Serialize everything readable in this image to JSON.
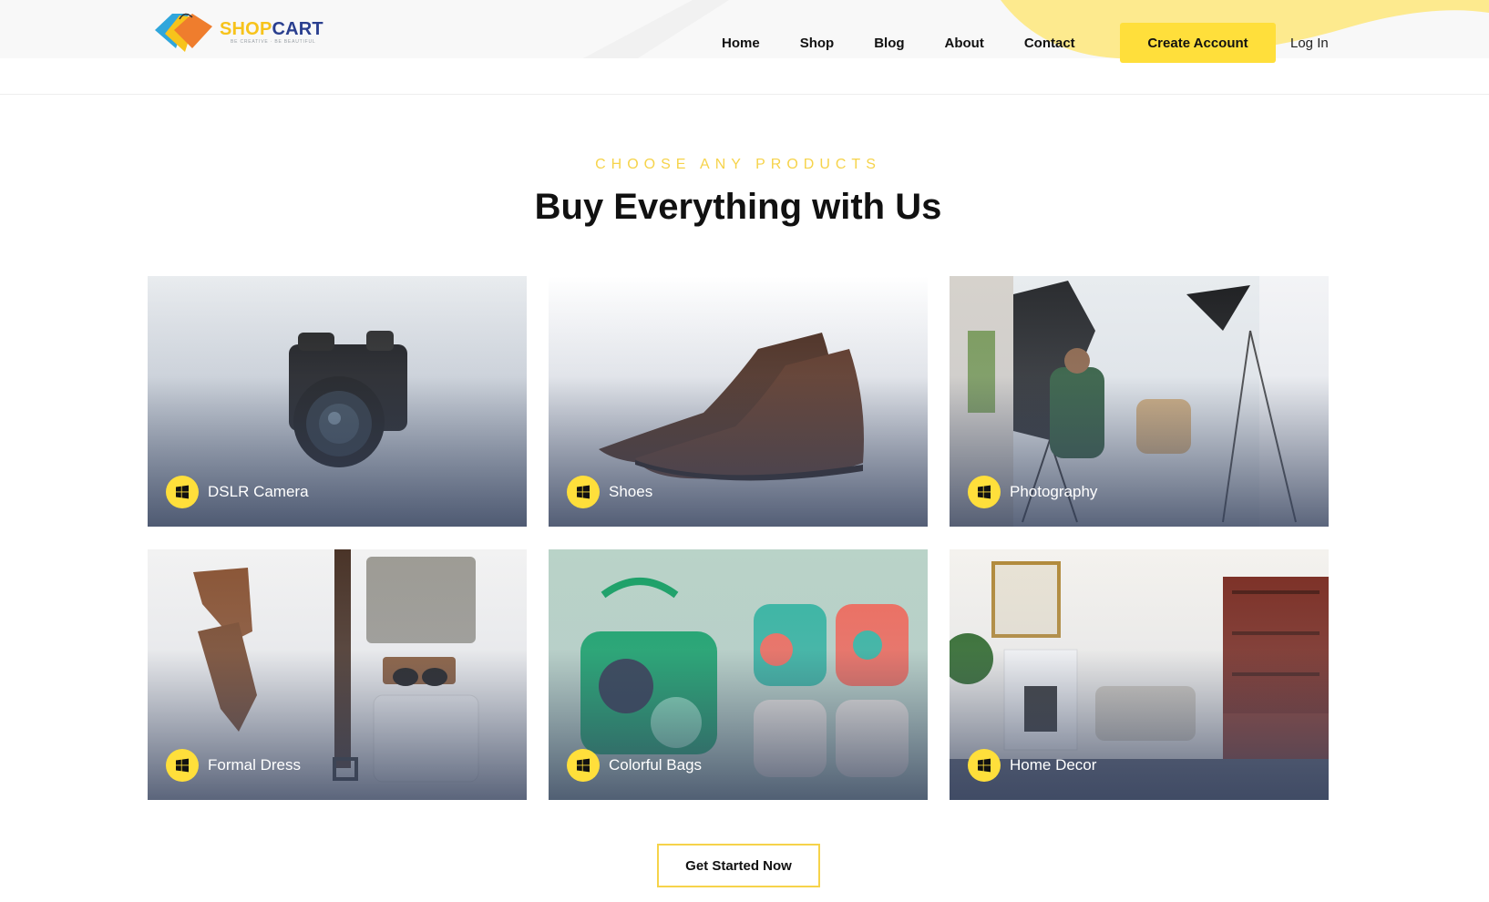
{
  "brand": {
    "name_part1": "SHOP",
    "name_part2": "CART",
    "tagline": "BE CREATIVE · BE BEAUTIFUL",
    "logo_icon": "shopping-tags-icon"
  },
  "nav": {
    "items": [
      {
        "label": "Home"
      },
      {
        "label": "Shop"
      },
      {
        "label": "Blog"
      },
      {
        "label": "About"
      },
      {
        "label": "Contact"
      }
    ],
    "create_account": "Create Account",
    "login": "Log In"
  },
  "section": {
    "eyebrow": "CHOOSE ANY PRODUCTS",
    "title": "Buy Everything with Us"
  },
  "categories": [
    {
      "label": "DSLR Camera",
      "icon": "windows-icon"
    },
    {
      "label": "Shoes",
      "icon": "windows-icon"
    },
    {
      "label": "Photography",
      "icon": "windows-icon"
    },
    {
      "label": "Formal Dress",
      "icon": "windows-icon"
    },
    {
      "label": "Colorful Bags",
      "icon": "windows-icon"
    },
    {
      "label": "Home Decor",
      "icon": "windows-icon"
    }
  ],
  "cta": {
    "label": "Get Started Now"
  },
  "colors": {
    "accent_yellow": "#ffdf3b",
    "eyebrow_yellow": "#f6d34a",
    "brand_blue": "#2a3f8f",
    "card_overlay": "#3a4661"
  }
}
